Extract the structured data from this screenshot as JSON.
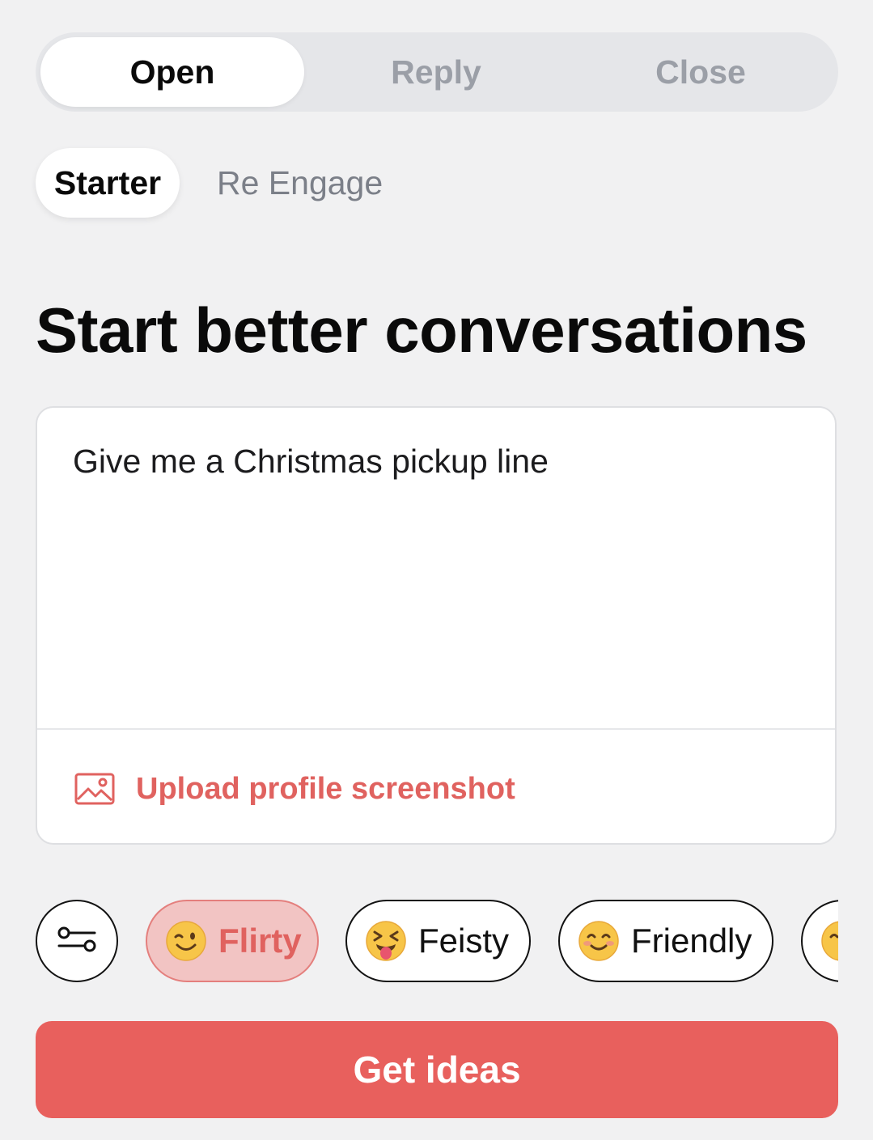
{
  "mode_tabs": [
    {
      "label": "Open",
      "active": true
    },
    {
      "label": "Reply",
      "active": false
    },
    {
      "label": "Close",
      "active": false
    }
  ],
  "sub_tabs": [
    {
      "label": "Starter",
      "active": true
    },
    {
      "label": "Re Engage",
      "active": false
    }
  ],
  "page_title": "Start better conversations",
  "prompt": {
    "value": "Give me a Christmas pickup line"
  },
  "upload": {
    "label": "Upload profile screenshot",
    "icon": "image-icon"
  },
  "tones": [
    {
      "label": "Flirty",
      "icon": "winking-face-emoji",
      "selected": true
    },
    {
      "label": "Feisty",
      "icon": "squinting-tongue-face-emoji",
      "selected": false
    },
    {
      "label": "Friendly",
      "icon": "smiling-face-emoji",
      "selected": false
    },
    {
      "label": "",
      "icon": "face-emoji",
      "selected": false
    }
  ],
  "settings_icon": "sliders-icon",
  "cta": {
    "label": "Get ideas"
  },
  "colors": {
    "accent": "#e8605d",
    "accent_text": "#e0625f",
    "selected_chip_bg": "#f2c4c3",
    "background": "#f1f1f2"
  }
}
